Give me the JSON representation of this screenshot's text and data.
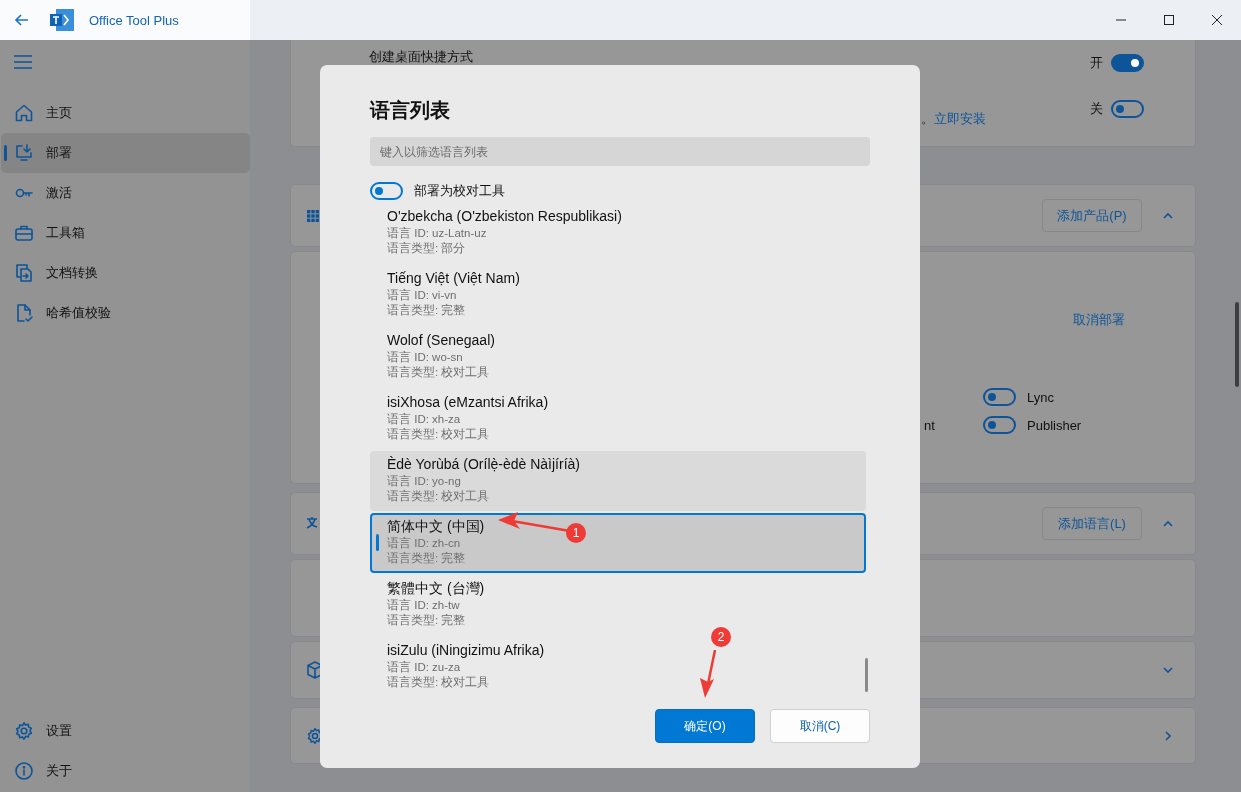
{
  "window": {
    "title": "Office Tool Plus"
  },
  "sidebar": {
    "items": [
      {
        "label": "主页",
        "kind": "home",
        "selected": false
      },
      {
        "label": "部署",
        "kind": "deploy",
        "selected": true
      },
      {
        "label": "激活",
        "kind": "key",
        "selected": false
      },
      {
        "label": "工具箱",
        "kind": "toolbox",
        "selected": false
      },
      {
        "label": "文档转换",
        "kind": "convert",
        "selected": false
      },
      {
        "label": "哈希值校验",
        "kind": "hash",
        "selected": false
      }
    ],
    "footer_items": [
      {
        "label": "设置",
        "kind": "settings",
        "selected": false
      },
      {
        "label": "关于",
        "kind": "about",
        "selected": false
      }
    ]
  },
  "main": {
    "shortcut_card": {
      "label": "创建桌面快捷方式",
      "toggles": [
        {
          "label": "开",
          "on": true
        },
        {
          "label": "关",
          "on": false
        }
      ],
      "note_tail": "。",
      "link": "立即安装"
    },
    "products_card": {
      "button": "添加产品(P)",
      "expanded": true
    },
    "product_panel": {
      "link": "取消部署",
      "clipped_label": "nt",
      "apps": [
        {
          "label": "Lync",
          "on": false
        },
        {
          "label": "Publisher",
          "on": false
        }
      ]
    },
    "languages_card": {
      "button": "添加语言(L)",
      "expanded": true
    },
    "package_card": {
      "expanded": false
    }
  },
  "dialog": {
    "title": "语言列表",
    "search": {
      "placeholder": "键入以筛选语言列表"
    },
    "proofing_toggle": {
      "label": "部署为校对工具",
      "on": false
    },
    "languages": [
      {
        "name": "O'zbekcha (O'zbekiston Respublikasi)",
        "id_line": "语言 ID: uz-Latn-uz",
        "type_line": "语言类型: 部分",
        "selected": false,
        "hovered": false
      },
      {
        "name": "Tiếng Việt (Việt Nam)",
        "id_line": "语言 ID: vi-vn",
        "type_line": "语言类型: 完整",
        "selected": false,
        "hovered": false
      },
      {
        "name": "Wolof (Senegaal)",
        "id_line": "语言 ID: wo-sn",
        "type_line": "语言类型: 校对工具",
        "selected": false,
        "hovered": false
      },
      {
        "name": "isiXhosa (eMzantsi Afrika)",
        "id_line": "语言 ID: xh-za",
        "type_line": "语言类型: 校对工具",
        "selected": false,
        "hovered": false
      },
      {
        "name": "Èdè Yorùbá (Orílẹ̀-èdè Nàìjíríà)",
        "id_line": "语言 ID: yo-ng",
        "type_line": "语言类型: 校对工具",
        "selected": false,
        "hovered": true
      },
      {
        "name": "简体中文 (中国)",
        "id_line": "语言 ID: zh-cn",
        "type_line": "语言类型: 完整",
        "selected": true,
        "hovered": false
      },
      {
        "name": "繁體中文 (台灣)",
        "id_line": "语言 ID: zh-tw",
        "type_line": "语言类型: 完整",
        "selected": false,
        "hovered": false
      },
      {
        "name": "isiZulu (iNingizimu Afrika)",
        "id_line": "语言 ID: zu-za",
        "type_line": "语言类型: 校对工具",
        "selected": false,
        "hovered": false
      }
    ],
    "buttons": [
      {
        "label": "确定(O)",
        "kind": "primary"
      },
      {
        "label": "取消(C)",
        "kind": "secondary"
      }
    ]
  },
  "annotations": [
    {
      "label": "1"
    },
    {
      "label": "2"
    }
  ]
}
